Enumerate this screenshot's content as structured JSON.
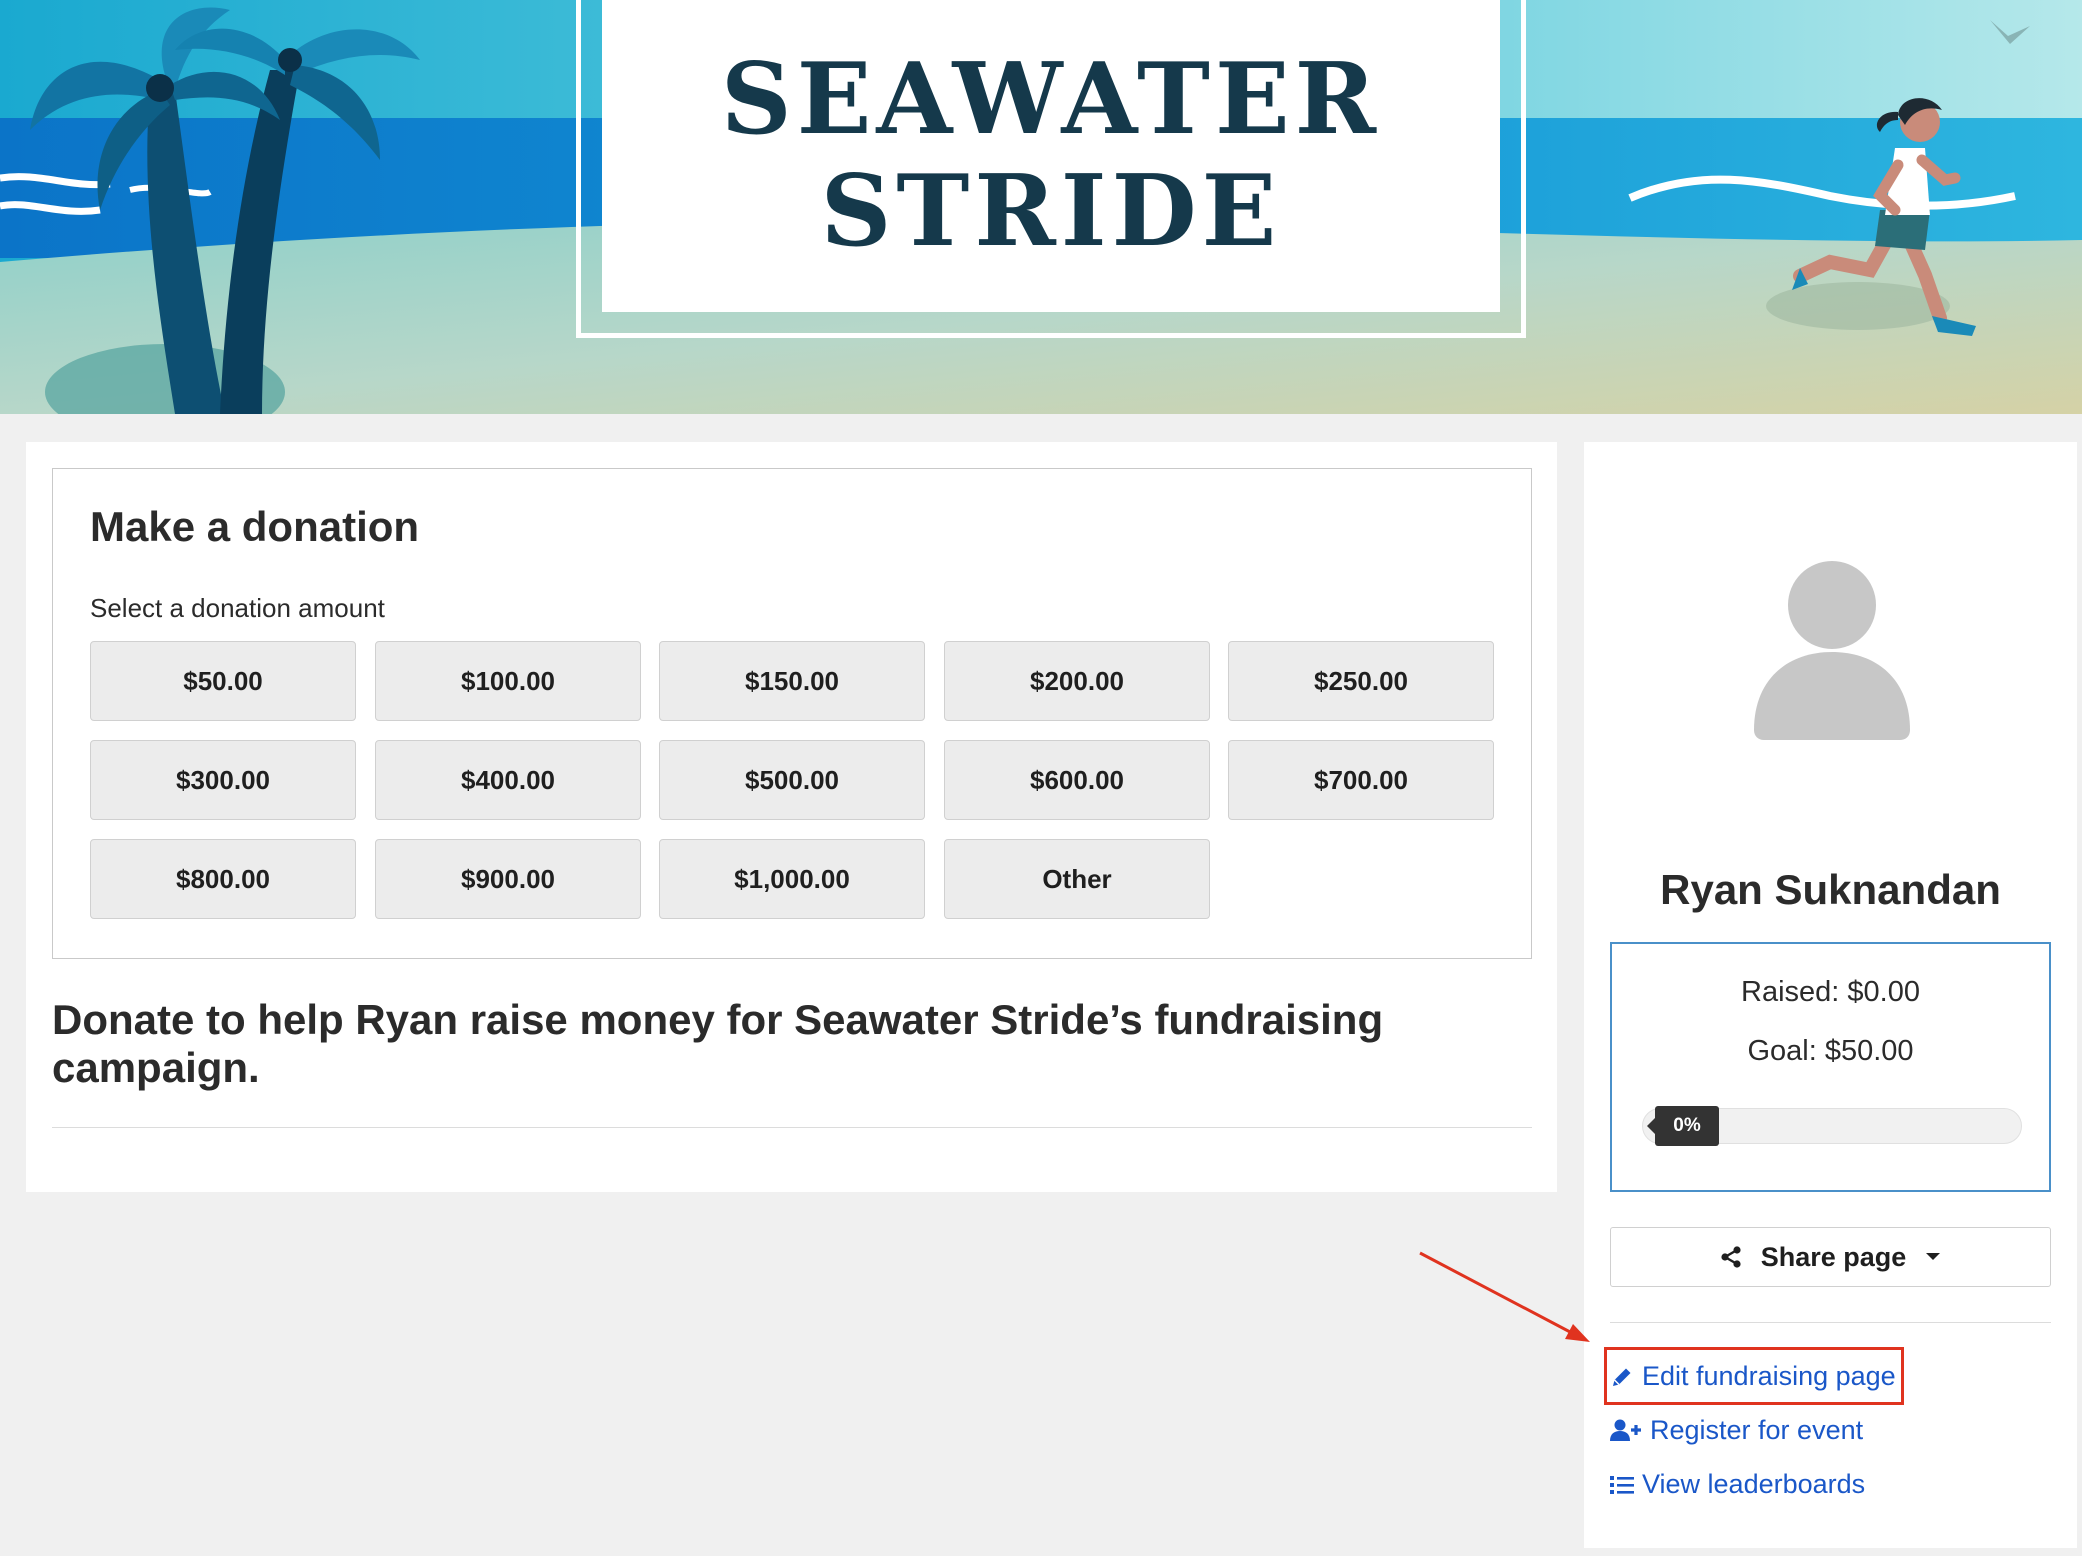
{
  "hero": {
    "title_line1": "SEAWATER",
    "title_line2": "STRIDE"
  },
  "donation": {
    "heading": "Make a donation",
    "subheading": "Select a donation amount",
    "amounts": [
      "$50.00",
      "$100.00",
      "$150.00",
      "$200.00",
      "$250.00",
      "$300.00",
      "$400.00",
      "$500.00",
      "$600.00",
      "$700.00",
      "$800.00",
      "$900.00",
      "$1,000.00",
      "Other"
    ]
  },
  "campaign": {
    "headline": "Donate to help Ryan raise money for Seawater Stride’s fundraising campaign."
  },
  "profile": {
    "name": "Ryan Suknandan",
    "raised": "Raised: $0.00",
    "goal": "Goal: $50.00",
    "progress_label": "0%",
    "progress_fraction": 0
  },
  "actions": {
    "share_label": "Share page",
    "edit_label": "Edit fundraising page",
    "register_label": "Register for event",
    "leaderboards_label": "View leaderboards"
  },
  "colors": {
    "link": "#1a57c8",
    "annotation": "#e0331f",
    "title": "#15394b",
    "stats_border": "#4a90c9"
  },
  "icons": [
    "user-avatar-icon",
    "share-icon",
    "caret-down-icon",
    "pencil-icon",
    "user-plus-icon",
    "list-icon",
    "palm-tree-icon",
    "runner-icon",
    "bird-icon"
  ]
}
